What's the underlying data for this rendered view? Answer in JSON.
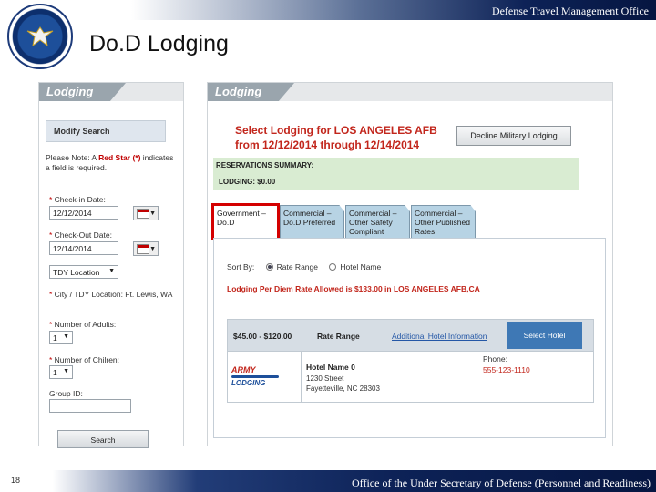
{
  "header": {
    "org": "Defense Travel Management Office",
    "title": "Do.D Lodging"
  },
  "left_panel": {
    "tab": "Lodging",
    "modify_search": "Modify Search",
    "note_prefix": "Please Note: A ",
    "note_red": "Red Star (*)",
    "note_suffix": " indicates a field is required.",
    "checkin_label": "Check-in Date:",
    "checkin_value": "12/12/2014",
    "checkout_label": "Check-Out Date:",
    "checkout_value": "12/14/2014",
    "tdy_location": "TDY Location",
    "city_label": "City / TDY Location: Ft. Lewis, WA",
    "adults_label": "Number of Adults:",
    "adults_value": "1",
    "children_label": "Number of Chilren:",
    "children_value": "1",
    "group_label": "Group ID:",
    "search_button": "Search"
  },
  "right_panel": {
    "tab": "Lodging",
    "heading_line1": "Select Lodging for LOS ANGELES AFB",
    "heading_line2": "from 12/12/2014 through 12/14/2014",
    "decline_button": "Decline Military Lodging",
    "summary_title": "RESERVATIONS SUMMARY:",
    "summary_lodging": "LODGING:    $0.00",
    "tabs": [
      {
        "label": "Government – Do.D"
      },
      {
        "label": "Commercial – Do.D Preferred"
      },
      {
        "label": "Commercial – Other Safety Compliant"
      },
      {
        "label": "Commercial – Other Published Rates"
      }
    ],
    "sort_by": "Sort By:",
    "sort_rate": "Rate Range",
    "sort_name": "Hotel Name",
    "perdiem": "Lodging Per Diem Rate Allowed is $133.00  in  LOS ANGELES AFB,CA",
    "hotel": {
      "rate": "$45.00 - $120.00",
      "rate_range": "Rate Range",
      "info_link": "Additional Hotel Information",
      "select": "Select Hotel",
      "logo_top": "ARMY",
      "logo_bottom": "LODGING",
      "name": "Hotel Name 0",
      "street": "1230 Street",
      "city": "Fayetteville, NC 28303",
      "phone_label": "Phone:",
      "phone": "555-123-1110"
    }
  },
  "footer": {
    "page_number": "18",
    "text": "Office of the Under Secretary of Defense (Personnel and Readiness)"
  },
  "colors": {
    "navy": "#0d2257",
    "red_text": "#c2261c",
    "summary_green": "#d9ecd2",
    "tab_blue": "#b7d3e4",
    "select_button": "#3e78b5"
  }
}
